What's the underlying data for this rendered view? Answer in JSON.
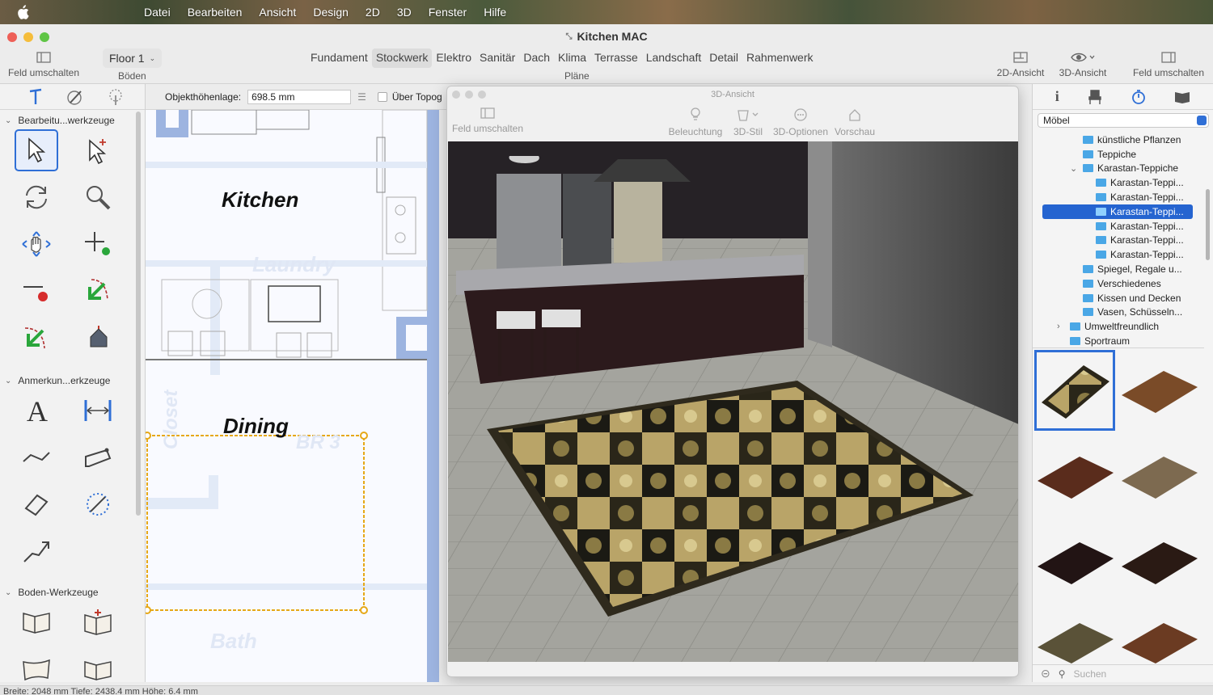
{
  "menubar": {
    "items": [
      "Datei",
      "Bearbeiten",
      "Ansicht",
      "Design",
      "2D",
      "3D",
      "Fenster",
      "Hilfe"
    ]
  },
  "window": {
    "title": "Kitchen MAC"
  },
  "toolbar": {
    "toggle_left": "Feld umschalten",
    "floor_select": "Floor 1",
    "floors_label": "Böden",
    "plans": [
      "Fundament",
      "Stockwerk",
      "Elektro",
      "Sanitär",
      "Dach",
      "Klima",
      "Terrasse",
      "Landschaft",
      "Detail",
      "Rahmenwerk"
    ],
    "active_plan": "Stockwerk",
    "plans_label": "Pläne",
    "view2d": "2D-Ansicht",
    "view3d": "3D-Ansicht",
    "toggle_right": "Feld umschalten"
  },
  "left_panel": {
    "section1": "Bearbeitu...werkzeuge",
    "section2": "Anmerkun...erkzeuge",
    "section3": "Boden-Werkzeuge"
  },
  "properties": {
    "height_label": "Objekthöhenlage:",
    "height_value": "698.5 mm",
    "checkbox_label": "Über Topog"
  },
  "plan": {
    "labels": {
      "kitchen": "Kitchen",
      "laundry": "Laundry",
      "dining": "Dining",
      "closet": "Closet",
      "br3": "BR 3",
      "bath": "Bath"
    }
  },
  "view3d": {
    "title": "3D-Ansicht",
    "toggle": "Feld umschalten",
    "lighting": "Beleuchtung",
    "style": "3D-Stil",
    "options": "3D-Optionen",
    "preview": "Vorschau"
  },
  "right_panel": {
    "category": "Möbel",
    "tree": [
      {
        "label": "künstliche Pflanzen",
        "indent": 1
      },
      {
        "label": "Teppiche",
        "indent": 1
      },
      {
        "label": "Karastan-Teppiche",
        "indent": 1,
        "expanded": true
      },
      {
        "label": "Karastan-Teppi...",
        "indent": 2
      },
      {
        "label": "Karastan-Teppi...",
        "indent": 2
      },
      {
        "label": "Karastan-Teppi...",
        "indent": 2,
        "selected": true
      },
      {
        "label": "Karastan-Teppi...",
        "indent": 2
      },
      {
        "label": "Karastan-Teppi...",
        "indent": 2
      },
      {
        "label": "Karastan-Teppi...",
        "indent": 2
      },
      {
        "label": "Spiegel, Regale u...",
        "indent": 1
      },
      {
        "label": "Verschiedenes",
        "indent": 1
      },
      {
        "label": "Kissen und Decken",
        "indent": 1
      },
      {
        "label": "Vasen, Schüsseln...",
        "indent": 1
      },
      {
        "label": "Umweltfreundlich",
        "indent": 0,
        "collapsed": true
      },
      {
        "label": "Sportraum",
        "indent": 0
      }
    ],
    "search_placeholder": "Suchen"
  },
  "status": {
    "text": "Breite: 2048 mm  Tiefe: 2438.4 mm  Höhe: 6.4 mm"
  },
  "colors": {
    "accent": "#2f6fd6",
    "selection": "#2564d0",
    "plan_wall": "#9db4e0",
    "select_outline": "#e6a817"
  }
}
